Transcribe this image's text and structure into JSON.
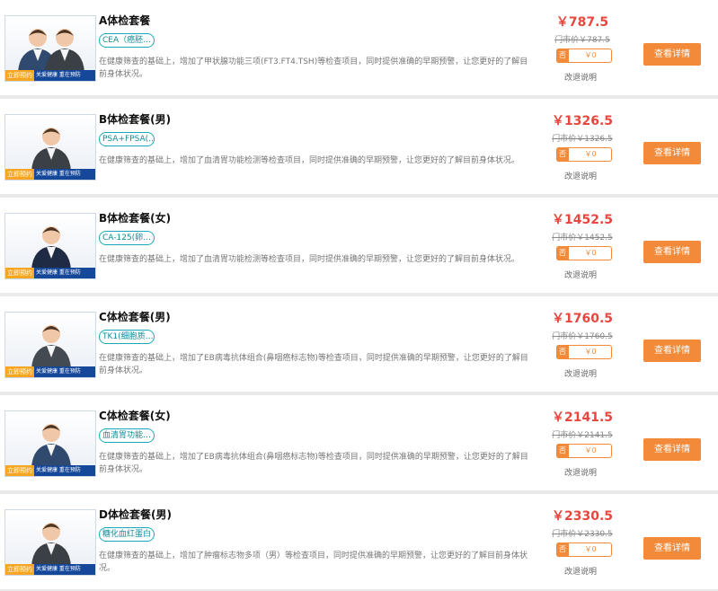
{
  "packages": [
    {
      "title": "A体检套餐",
      "tag": "CEA（癌胚…",
      "description": "在健康筛查的基础上，增加了甲状腺功能三项(FT3.FT4.TSH)等检查项目，同时提供准确的早期预警，让您更好的了解目前身体状况。",
      "price": "￥787.5",
      "market_price": "门市价￥787.5",
      "deposit_check": "否",
      "deposit_amount": "￥0",
      "refund_label": "改退说明",
      "detail_label": "查看详情",
      "badge": "立即预约",
      "slogan": "关爱健康 重在预防",
      "people": 2
    },
    {
      "title": "B体检套餐(男)",
      "tag": "PSA+FPSA(…",
      "description": "在健康筛查的基础上，增加了血清胃功能检测等检查项目，同时提供准确的早期预警，让您更好的了解目前身体状况。",
      "price": "￥1326.5",
      "market_price": "门市价￥1326.5",
      "deposit_check": "否",
      "deposit_amount": "￥0",
      "refund_label": "改退说明",
      "detail_label": "查看详情",
      "badge": "立即预约",
      "slogan": "关爱健康 重在预防",
      "people": 1
    },
    {
      "title": "B体检套餐(女)",
      "tag": "CA-125(卵…",
      "description": "在健康筛查的基础上，增加了血清胃功能检测等检查项目，同时提供准确的早期预警，让您更好的了解目前身体状况。",
      "price": "￥1452.5",
      "market_price": "门市价￥1452.5",
      "deposit_check": "否",
      "deposit_amount": "￥0",
      "refund_label": "改退说明",
      "detail_label": "查看详情",
      "badge": "立即预约",
      "slogan": "关爱健康 重在预防",
      "people": 1
    },
    {
      "title": "C体检套餐(男)",
      "tag": "TK1(细胞质…",
      "description": "在健康筛查的基础上，增加了EB病毒抗体组合(鼻咽癌标志物)等检查项目，同时提供准确的早期预警，让您更好的了解目前身体状况。",
      "price": "￥1760.5",
      "market_price": "门市价￥1760.5",
      "deposit_check": "否",
      "deposit_amount": "￥0",
      "refund_label": "改退说明",
      "detail_label": "查看详情",
      "badge": "立即预约",
      "slogan": "关爱健康 重在预防",
      "people": 1
    },
    {
      "title": "C体检套餐(女)",
      "tag": "血清胃功能…",
      "description": "在健康筛查的基础上，增加了EB病毒抗体组合(鼻咽癌标志物)等检查项目，同时提供准确的早期预警，让您更好的了解目前身体状况。",
      "price": "￥2141.5",
      "market_price": "门市价￥2141.5",
      "deposit_check": "否",
      "deposit_amount": "￥0",
      "refund_label": "改退说明",
      "detail_label": "查看详情",
      "badge": "立即预约",
      "slogan": "关爱健康 重在预防",
      "people": 1
    },
    {
      "title": "D体检套餐(男)",
      "tag": "糖化血红蛋白",
      "description": "在健康筛查的基础上，增加了肿瘤标志物多项（男）等检查项目，同时提供准确的早期预警，让您更好的了解目前身体状况。",
      "price": "￥2330.5",
      "market_price": "门市价￥2330.5",
      "deposit_check": "否",
      "deposit_amount": "￥0",
      "refund_label": "改退说明",
      "detail_label": "查看详情",
      "badge": "立即预约",
      "slogan": "关爱健康 重在预防",
      "people": 1
    }
  ],
  "colors": {
    "price": "#e8463e",
    "accent": "#f28a3a",
    "tag": "#1aa9b8",
    "band": "#16489a"
  }
}
